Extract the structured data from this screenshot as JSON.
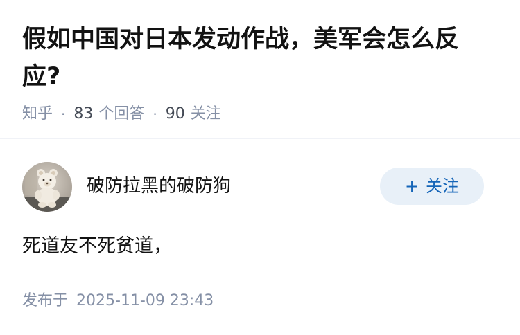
{
  "question": {
    "title": "假如中国对日本发动作战，美军会怎么反应?",
    "source": "知乎",
    "separator": "·",
    "answer_count": "83",
    "answer_label": "个回答",
    "follower_count": "90",
    "follower_label": "关注"
  },
  "answer": {
    "author_name": "破防拉黑的破防狗",
    "follow_button": {
      "icon": "plus-icon",
      "icon_glyph": "+",
      "label": "关注",
      "color": "#1565b8",
      "background": "#e8f0f8"
    },
    "content": "死道友不死贫道，",
    "publish_label": "发布于",
    "publish_time": "2025-11-09 23:43"
  }
}
